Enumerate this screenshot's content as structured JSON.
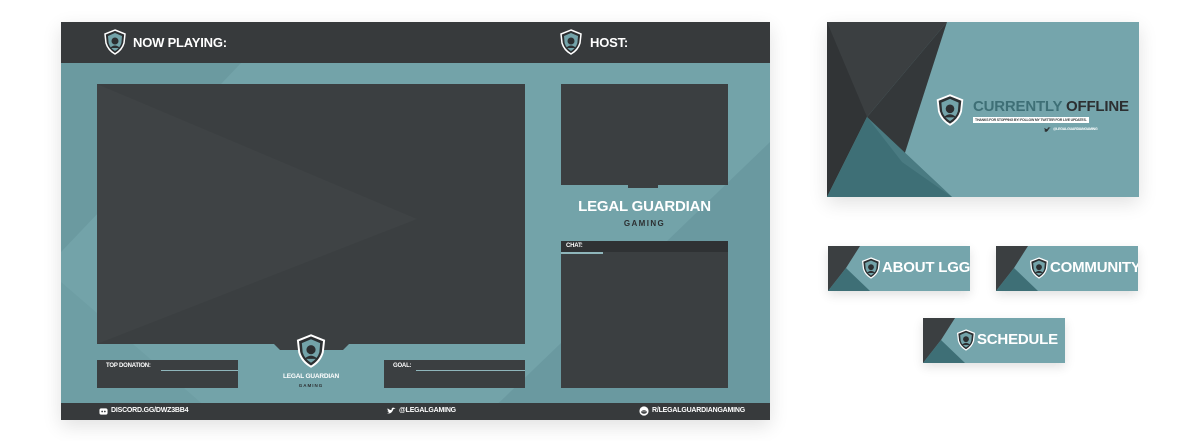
{
  "overlay": {
    "now_playing_label": "NOW PLAYING:",
    "host_label": "HOST:",
    "top_donation_label": "TOP DONATION:",
    "goal_label": "GOAL:",
    "chat_label": "CHAT:",
    "brand_name": "LEGAL GUARDIAN",
    "brand_sub": "GAMING",
    "bottom_brand_name": "LEGAL GUARDIAN",
    "bottom_brand_sub": "GAMING",
    "discord_text": "DISCORD.GG/DWZ3BB4",
    "twitter_text": "@LEGALGAMING",
    "reddit_text": "R/LEGALGUARDIANGAMING"
  },
  "offline": {
    "title_part1": "CURRENTLY",
    "title_part2": "OFFLINE",
    "subtitle": "THANKS FOR STOPPING BY! FOLLOW MY TWITTER FOR LIVE UPDATES.",
    "twitter": "@LEGALGUARDIANGAMING"
  },
  "buttons": {
    "about": "ABOUT LGG",
    "community": "COMMUNITY",
    "schedule": "SCHEDULE"
  },
  "colors": {
    "teal": "#73a3a9",
    "dark": "#373a3c",
    "frame": "#3b3f41",
    "white": "#ffffff"
  },
  "icons": [
    "shield-logo-icon",
    "discord-icon",
    "twitter-icon",
    "reddit-icon"
  ]
}
